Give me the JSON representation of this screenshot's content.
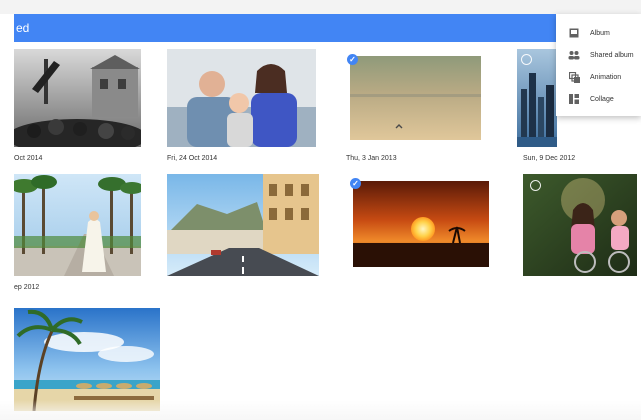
{
  "app_bar": {
    "title": "ed",
    "color": "#4285f4"
  },
  "dates": {
    "row1": [
      "Oct 2014",
      "Fri, 24 Oct 2014",
      "Thu, 3 Jan 2013",
      "Sun, 9 Dec 2012"
    ],
    "row2": [
      "ep 2012"
    ]
  },
  "photos": [
    {
      "name": "celebration-crowd-photo",
      "selected": false
    },
    {
      "name": "family-portrait-photo",
      "selected": false
    },
    {
      "name": "beach-bird-photo",
      "selected": true
    },
    {
      "name": "city-skyline-photo",
      "selected": false,
      "unselected_ring": true
    },
    {
      "name": "palm-avenue-bride-photo",
      "selected": false
    },
    {
      "name": "coastal-street-photo",
      "selected": false
    },
    {
      "name": "sunset-photo",
      "selected": true
    },
    {
      "name": "children-bicycle-photo",
      "selected": false,
      "unselected_ring": true
    },
    {
      "name": "tropical-beach-photo",
      "selected": false
    }
  ],
  "create_menu": {
    "items": [
      {
        "label": "Album",
        "icon": "album-icon"
      },
      {
        "label": "Shared album",
        "icon": "shared-album-icon"
      },
      {
        "label": "Animation",
        "icon": "animation-icon"
      },
      {
        "label": "Collage",
        "icon": "collage-icon"
      }
    ]
  },
  "colors": {
    "accent": "#4285f4",
    "menu_bg": "#ffffff"
  }
}
